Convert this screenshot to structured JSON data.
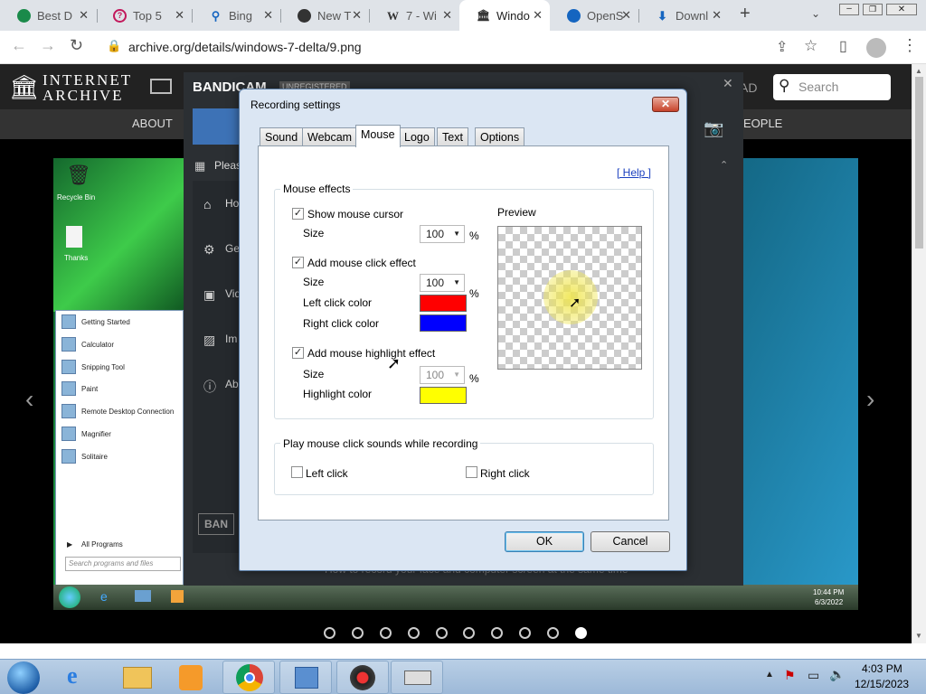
{
  "browser": {
    "tabs": [
      {
        "label": "Best D",
        "icon": "grid-icon",
        "color": "#1a8a4a"
      },
      {
        "label": "Top 5",
        "icon": "question-icon",
        "color": "#c2185b"
      },
      {
        "label": "Bing",
        "icon": "search-icon",
        "color": "#1565c0"
      },
      {
        "label": "New T",
        "icon": "github-icon",
        "color": "#333"
      },
      {
        "label": "7 - Wi",
        "icon": "wikipedia-icon",
        "color": "#333"
      },
      {
        "label": "Windo",
        "icon": "archive-icon",
        "color": "#333"
      },
      {
        "label": "OpenS",
        "icon": "globe-icon",
        "color": "#1565c0"
      },
      {
        "label": "Downl",
        "icon": "download-icon",
        "color": "#1565c0"
      }
    ],
    "url": "archive.org/details/windows-7-delta/9.png"
  },
  "ia": {
    "logo_line1": "INTERNET",
    "logo_line2": "ARCHIVE",
    "search_placeholder": "Search",
    "menu_about": "ABOUT",
    "menu_people": "EOPLE",
    "menu_ad": "AD"
  },
  "bandicam": {
    "brand": "BANDICAM",
    "unregistered": "UNREGISTERED",
    "please": "Pleas",
    "side": [
      "Ho",
      "Ge",
      "Vid",
      "Im",
      "Ab"
    ],
    "btn": "BAN",
    "footer": "How to record your face and computer screen at the same time"
  },
  "dialog": {
    "title": "Recording settings",
    "tabs": [
      "Sound",
      "Webcam",
      "Mouse",
      "Logo",
      "Text",
      "Options"
    ],
    "help": "[ Help ]",
    "group_mouse": "Mouse effects",
    "show_cursor": "Show mouse cursor",
    "size": "Size",
    "size1": "100",
    "size2": "100",
    "size3": "100",
    "percent": "%",
    "click_effect": "Add mouse click effect",
    "left_color": "Left click color",
    "right_color": "Right click color",
    "highlight_effect": "Add mouse highlight effect",
    "highlight_color": "Highlight color",
    "preview": "Preview",
    "group_sounds": "Play mouse click sounds while recording",
    "left_click": "Left click",
    "right_click": "Right click",
    "ok": "OK",
    "cancel": "Cancel",
    "colors": {
      "left": "#ff0000",
      "right": "#0000ff",
      "highlight": "#ffff00"
    }
  },
  "win7": {
    "recycle": "Recycle Bin",
    "thanks": "Thanks",
    "start_items": [
      "Getting Started",
      "Calculator",
      "Snipping Tool",
      "Paint",
      "Remote Desktop Connection",
      "Magnifier",
      "Solitaire"
    ],
    "all_programs": "All Programs",
    "search_programs": "Search programs and files",
    "time": "10:44 PM",
    "date": "6/3/2022"
  },
  "taskbar": {
    "time": "4:03 PM",
    "date": "12/15/2023"
  }
}
